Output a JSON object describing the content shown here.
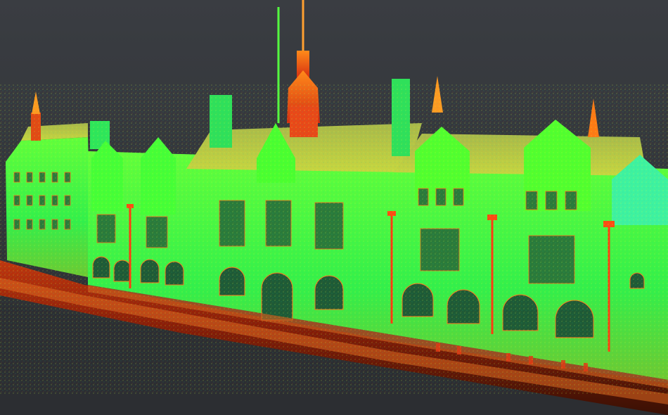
{
  "viewer": {
    "content": "point-cloud-scan-building",
    "background_top": "#3a3d42",
    "background_bottom": "#2a2c30"
  },
  "palette": {
    "facade_green": "#3cff3a",
    "facade_light": "#7dff2e",
    "facade_cyan": "#25e68a",
    "roof_yellow": "#b7c845",
    "accent_red": "#e23a12",
    "accent_orange": "#ff7a12",
    "ground_red": "#8c1e08",
    "ground_dark": "#3a1004"
  }
}
